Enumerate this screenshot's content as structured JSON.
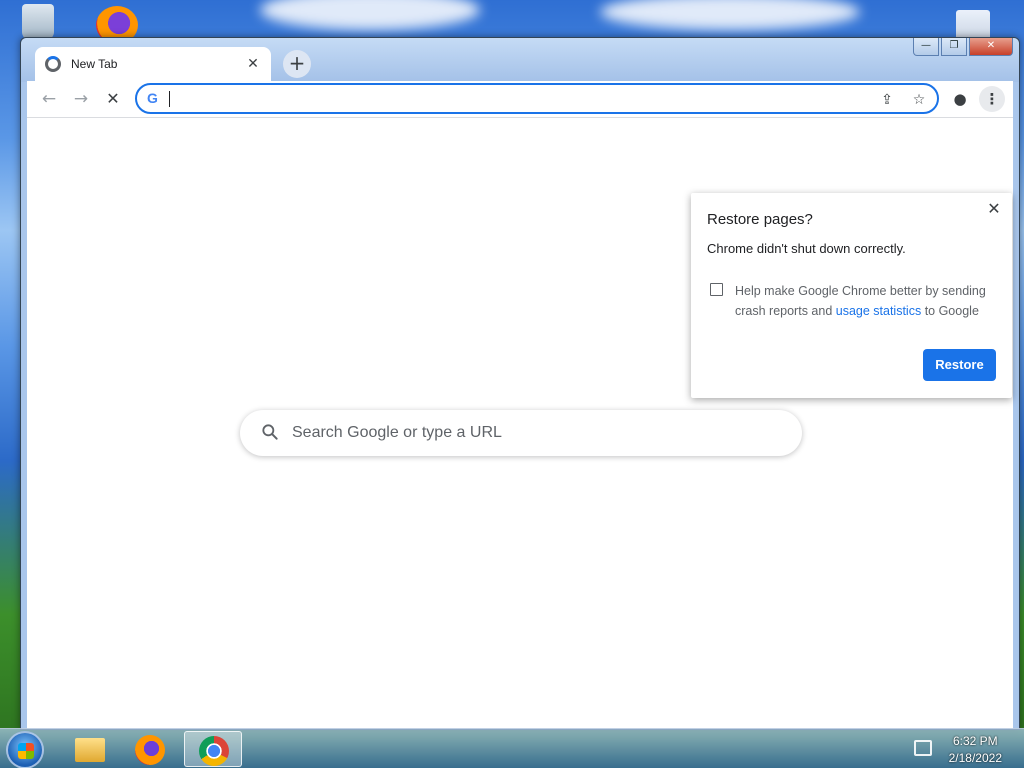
{
  "browser": {
    "tab": {
      "title": "New Tab",
      "close": "✕"
    },
    "new_tab": "+",
    "window_controls": {
      "minimize": "—",
      "maximize": "❐",
      "close": "✕"
    }
  },
  "toolbar": {
    "back": "←",
    "forward": "→",
    "stop": "✕",
    "omnibox": {
      "value": "",
      "icon": "G"
    },
    "share": "⇪",
    "bookmark": "☆",
    "profile": "●",
    "menu": "⋮"
  },
  "ntp": {
    "search_placeholder": "Search Google or type a URL"
  },
  "restore_bubble": {
    "title": "Restore pages?",
    "message": "Chrome didn't shut down correctly.",
    "consent_prefix": "Help make Google Chrome better by sending crash reports and ",
    "consent_link": "usage statistics",
    "consent_suffix": " to Google",
    "checkbox_checked": false,
    "restore_label": "Restore",
    "close": "✕"
  },
  "taskbar": {
    "items": [
      "windows-explorer",
      "firefox",
      "google-chrome"
    ],
    "active": "google-chrome",
    "clock": {
      "time": "6:32 PM",
      "date": "2/18/2022"
    }
  },
  "colors": {
    "accent": "#1a73e8",
    "bubble_bg": "#ffffff",
    "toolbar_bg": "#ffffff"
  }
}
